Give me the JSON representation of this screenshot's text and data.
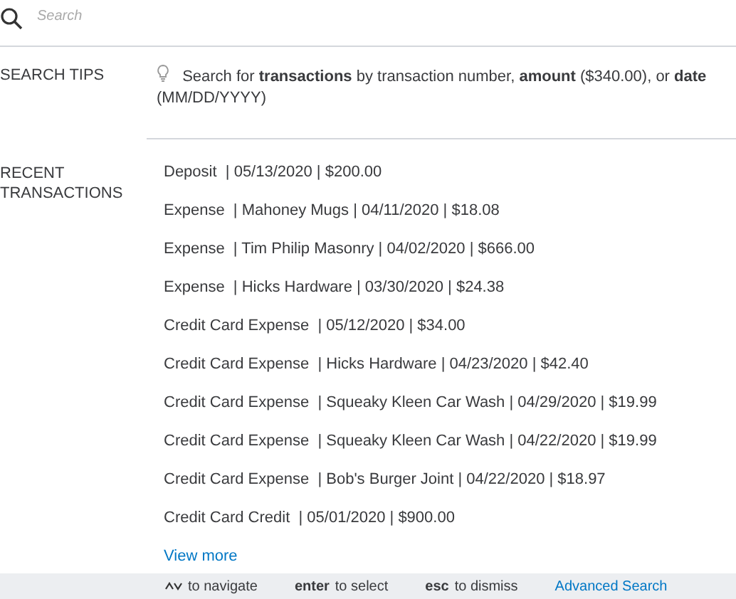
{
  "search": {
    "placeholder": "Search"
  },
  "search_tips": {
    "label": "SEARCH TIPS",
    "text": "Search for **transactions** by transaction number, **amount** ($340.00), or **date** (MM/DD/YYYY)"
  },
  "recent_transactions": {
    "label": "RECENT TRANSACTIONS",
    "items": [
      "Deposit  | 05/13/2020 | $200.00",
      "Expense  | Mahoney Mugs | 04/11/2020 | $18.08",
      "Expense  | Tim Philip Masonry | 04/02/2020 | $666.00",
      "Expense  | Hicks Hardware | 03/30/2020 | $24.38",
      "Credit Card Expense  | 05/12/2020 | $34.00",
      "Credit Card Expense  | Hicks Hardware | 04/23/2020 | $42.40",
      "Credit Card Expense  | Squeaky Kleen Car Wash | 04/29/2020 | $19.99",
      "Credit Card Expense  | Squeaky Kleen Car Wash | 04/22/2020 | $19.99",
      "Credit Card Expense  | Bob's Burger Joint | 04/22/2020 | $18.97",
      "Credit Card Credit  | 05/01/2020 | $900.00"
    ],
    "view_more": "View more"
  },
  "footer": {
    "hints": [
      {
        "kind": "arrows",
        "action": "to navigate"
      },
      {
        "kind": "key",
        "key": "enter",
        "action": "to select"
      },
      {
        "kind": "key",
        "key": "esc",
        "action": "to dismiss"
      }
    ],
    "advanced_search": "Advanced Search"
  }
}
